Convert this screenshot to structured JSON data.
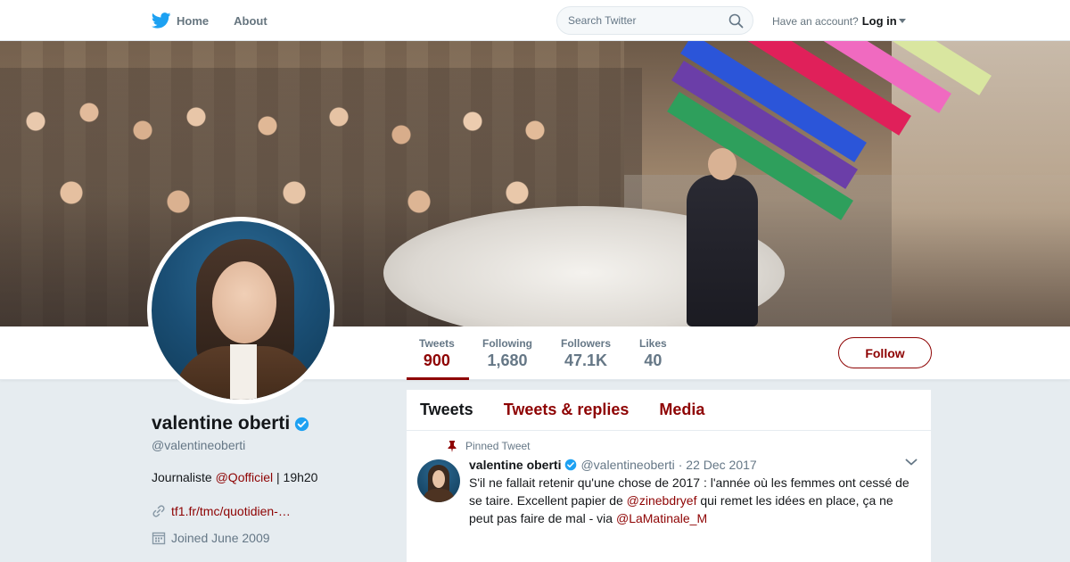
{
  "nav": {
    "home_label": "Home",
    "about_label": "About",
    "search_placeholder": "Search Twitter",
    "account_prompt": "Have an account?",
    "login_label": "Log in"
  },
  "colors": {
    "accent": "#8e0303",
    "twitter_blue": "#1da1f2",
    "verified": "#1da1f2"
  },
  "stats": [
    {
      "label": "Tweets",
      "value": "900"
    },
    {
      "label": "Following",
      "value": "1,680"
    },
    {
      "label": "Followers",
      "value": "47.1K"
    },
    {
      "label": "Likes",
      "value": "40"
    }
  ],
  "follow_label": "Follow",
  "profile": {
    "name": "valentine oberti",
    "handle": "@valentineoberti",
    "bio_prefix": "Journaliste ",
    "bio_mention": "@Qofficiel",
    "bio_suffix": " | 19h20",
    "website": "tf1.fr/tmc/quotidien-…",
    "joined": "Joined June 2009"
  },
  "timeline": {
    "tabs": [
      "Tweets",
      "Tweets & replies",
      "Media"
    ],
    "pinned_label": "Pinned Tweet",
    "tweet": {
      "name": "valentine oberti",
      "handle": "@valentineoberti",
      "date": "· 22 Dec 2017",
      "text_1": "S'il ne fallait retenir qu'une chose de 2017 : l'année où les femmes ont cessé de se taire. Excellent papier de ",
      "mention_1": "@zinebdryef",
      "text_2": " qui remet les idées en place, ça ne peut pas faire de mal - via ",
      "mention_2": "@LaMatinale_M"
    }
  },
  "icons": [
    "twitter-bird-icon",
    "search-icon",
    "verified-badge-icon",
    "link-icon",
    "calendar-icon",
    "pin-icon",
    "chevron-down-icon"
  ]
}
